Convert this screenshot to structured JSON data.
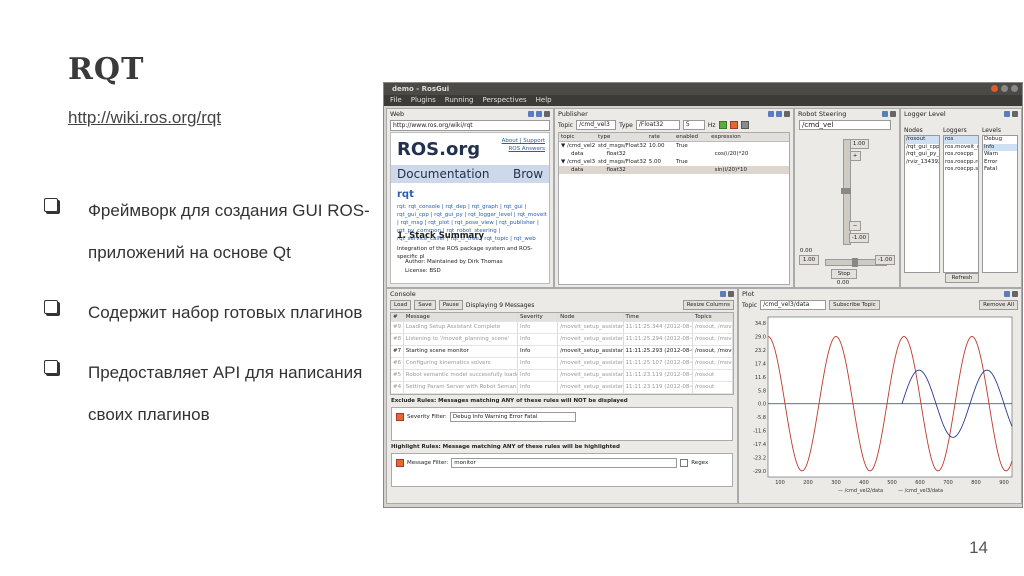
{
  "slide": {
    "title": "RQT",
    "link": "http://wiki.ros.org/rqt",
    "bullets": [
      "Фреймворк для создания GUI ROS-приложений на основе Qt",
      "Содержит набор готовых плагинов",
      "Предоставляет API для написания своих плагинов"
    ],
    "page_number": "14"
  },
  "screenshot": {
    "window_title": "demo - RosGui",
    "menu": [
      "File",
      "Plugins",
      "Running",
      "Perspectives",
      "Help"
    ],
    "web": {
      "header": "Web",
      "url": "http://www.ros.org/wiki/rqt",
      "logo": "ROS.org",
      "top_links": [
        "About | Support",
        "ROS Answers"
      ],
      "band_left": "Documentation",
      "band_right": "Brow",
      "page_name": "rqt",
      "wiki_links": "rqt: rqt_console | rqt_dep | rqt_graph | rqt_gui | rqt_gui_cpp | rqt_gui_py | rqt_logger_level | rqt_moveit | rqt_msg | rqt_plot | rqt_pose_view | rqt_publisher | rqt_py_common | rqt_robot_steering | rqt_service_caller | rqt_tf_tree | rqt_topic | rqt_web",
      "heading": "1. Stack Summary",
      "para": "Integration of the ROS package system and ROS-specific pl",
      "list_items": [
        "Author: Maintained by Dirk Thomas",
        "License: BSD"
      ]
    },
    "publisher": {
      "header": "Publisher",
      "topic_label": "Topic",
      "topic_value": "/cmd_vel3",
      "type_label": "Type",
      "type_value": "/Float32",
      "freq_value": "5",
      "freq_unit": "Hz",
      "columns": [
        "topic",
        "type",
        "rate",
        "enabled",
        "expression"
      ],
      "rows": [
        [
          "▼ /cmd_vel2",
          "std_msgs/Float32",
          "10.00",
          "True",
          ""
        ],
        [
          "data",
          "float32",
          "",
          "",
          "cos(i/20)*20"
        ],
        [
          "▼ /cmd_vel3",
          "std_msgs/Float32",
          "5.00",
          "True",
          ""
        ],
        [
          "data",
          "float32",
          "",
          "",
          "sin(i/20)*10"
        ]
      ]
    },
    "steering": {
      "header": "Robot Steering",
      "topic_value": "/cmd_vel",
      "top_value": "1.00",
      "bottom_value": "-1.00",
      "left_value": "1.00",
      "right_value": "-1.00",
      "stop_label": "Stop",
      "zero_a": "0.00",
      "zero_b": "0.00"
    },
    "logger": {
      "header": "Logger Level",
      "nodes_label": "Nodes",
      "loggers_label": "Loggers",
      "levels_label": "Levels",
      "nodes": [
        "/rosout",
        "/rqt_gui_cpp_",
        "/rqt_gui_py_n",
        "/rviz_134392"
      ],
      "loggers": [
        "ros",
        "ros.moveit_co",
        "ros.roscpp",
        "ros.roscpp.ro",
        "ros.roscpp.su"
      ],
      "levels": [
        "Debug",
        "Info",
        "Warn",
        "Error",
        "Fatal"
      ],
      "refresh_label": "Refresh"
    },
    "console": {
      "header": "Console",
      "load_label": "Load",
      "save_label": "Save",
      "pause_label": "Pause",
      "displaying": "Displaying 9 Messages",
      "resize_label": "Resize Columns",
      "columns": [
        "#",
        "Message",
        "Severity",
        "Node",
        "Time",
        "Topics"
      ],
      "rows": [
        [
          "#9",
          "Loading Setup Assistant Complete",
          "Info",
          "/moveit_setup_assistan",
          "11:11:25.344 (2012-08-02)",
          "/rosout, /move"
        ],
        [
          "#8",
          "Listening to '/moveit_planning_scene'",
          "Info",
          "/moveit_setup_assistan",
          "11:11:25.294 (2012-08-02)",
          "/rosout, /move"
        ],
        [
          "#7",
          "Starting scene monitor",
          "Info",
          "/moveit_setup_assistan",
          "11:11:25.293 (2012-08-02)",
          "/rosout, /move"
        ],
        [
          "#6",
          "Configuring kinematics solvers",
          "Info",
          "/moveit_setup_assistan",
          "11:11:25.107 (2012-08-02)",
          "/rosout, /move"
        ],
        [
          "#5",
          "Robot semantic model successfully loaded.",
          "Info",
          "/moveit_setup_assistan",
          "11:11:23.119 (2012-08-02)",
          "/rosout"
        ],
        [
          "#4",
          "Setting Param Server with Robot Seman...",
          "Info",
          "/moveit_setup_assistan",
          "11:11:23.119 (2012-08-02)",
          "/rosout"
        ]
      ],
      "exclude_title": "Exclude Rules: Messages matching ANY of these rules will NOT be displayed",
      "severity_filter_label": "Severity Filter:",
      "severity_values": "Debug  Info  Warning  Error  Fatal",
      "highlight_title": "Highlight Rules: Message matching ANY of these rules will be highlighted",
      "message_filter_label": "Message Filter:",
      "message_filter_value": "monitor",
      "regex_label": "Regex"
    },
    "plot": {
      "header": "Plot",
      "topic_label": "Topic",
      "topic_value": "/cmd_vel3/data",
      "subscribe_label": "Subscribe Topic",
      "remove_label": "Remove All",
      "y_ticks": [
        "34.8",
        "29.0",
        "23.2",
        "17.4",
        "11.6",
        "5.8",
        "0.0",
        "-5.8",
        "-11.6",
        "-17.4",
        "-23.2",
        "-29.0"
      ],
      "x_ticks": [
        "100",
        "200",
        "300",
        "400",
        "500",
        "600",
        "700",
        "800",
        "900"
      ],
      "legend": [
        "— /cmd_vel2/data",
        "— /cmd_vel3/data"
      ],
      "colors": {
        "vel2": "#c0392b",
        "vel3": "#2b3a8c"
      }
    }
  }
}
